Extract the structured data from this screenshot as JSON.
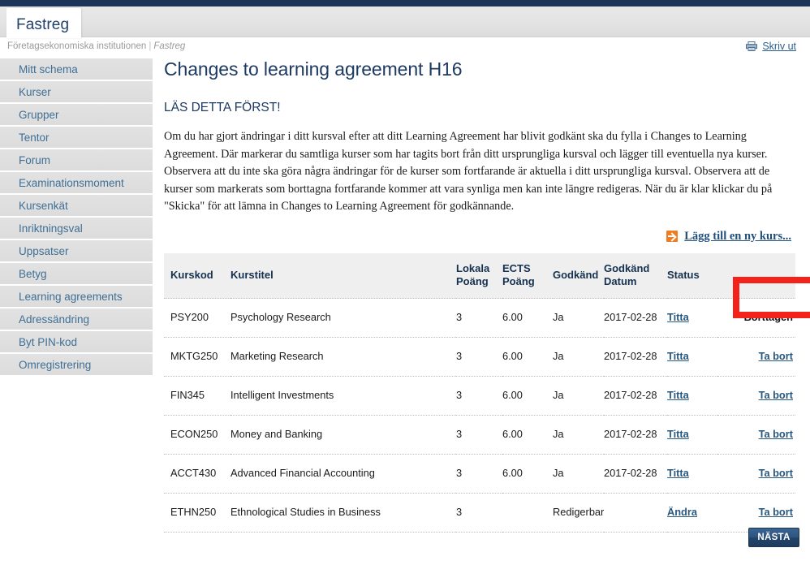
{
  "topbar": {
    "color": "#1d3557"
  },
  "tab": {
    "label": "Fastreg"
  },
  "breadcrumb": {
    "root": "Företagsekonomiska institutionen",
    "separator": "|",
    "current": "Fastreg"
  },
  "print": {
    "label": "Skriv ut",
    "icon": "printer-icon"
  },
  "sidebar": {
    "items": [
      {
        "label": "Mitt schema"
      },
      {
        "label": "Kurser"
      },
      {
        "label": "Grupper"
      },
      {
        "label": "Tentor"
      },
      {
        "label": "Forum"
      },
      {
        "label": "Examinationsmoment"
      },
      {
        "label": "Kursenkät"
      },
      {
        "label": "Inriktningsval"
      },
      {
        "label": "Uppsatser"
      },
      {
        "label": "Betyg"
      },
      {
        "label": "Learning agreements"
      },
      {
        "label": "Adressändring"
      },
      {
        "label": "Byt PIN-kod"
      },
      {
        "label": "Omregistrering"
      }
    ]
  },
  "main": {
    "title": "Changes to learning agreement H16",
    "subhead": "LÄS DETTA FÖRST!",
    "body": "Om du har gjort ändringar i ditt kursval efter att ditt Learning Agreement har blivit godkänt ska du fylla i Changes to Learning Agreement. Där markerar du samtliga kurser som har tagits bort från ditt ursprungliga kursval och lägger till eventuella nya kurser. Observera att du inte ska göra några ändringar för de kurser som fortfarande är aktuella i ditt ursprungliga kursval. Observera att de kurser som markerats som borttagna fortfarande kommer att vara synliga men kan inte längre redigeras. När du är klar klickar du på \"Skicka\" för att lämna in Changes to Learning Agreement för godkännande.",
    "add_course_link": "Lägg till en ny kurs...",
    "next_button": "NÄSTA"
  },
  "table": {
    "headers": {
      "kurskod": "Kurskod",
      "kurstitel": "Kurstitel",
      "lokala_poang": "Lokala Poäng",
      "ects_poang": "ECTS Poäng",
      "godkand": "Godkänd",
      "godkand_datum": "Godkänd Datum",
      "status": "Status",
      "action": ""
    },
    "rows": [
      {
        "kurskod": "PSY200",
        "kurstitel": "Psychology Research",
        "lokala_poang": "3",
        "ects_poang": "6.00",
        "godkand": "Ja",
        "godkand_datum": "2017-02-28",
        "status": "Titta",
        "action": "Borttagen",
        "action_is_link": false,
        "highlighted": true
      },
      {
        "kurskod": "MKTG250",
        "kurstitel": "Marketing Research",
        "lokala_poang": "3",
        "ects_poang": "6.00",
        "godkand": "Ja",
        "godkand_datum": "2017-02-28",
        "status": "Titta",
        "action": "Ta bort",
        "action_is_link": true,
        "highlighted": false
      },
      {
        "kurskod": "FIN345",
        "kurstitel": "Intelligent Investments",
        "lokala_poang": "3",
        "ects_poang": "6.00",
        "godkand": "Ja",
        "godkand_datum": "2017-02-28",
        "status": "Titta",
        "action": "Ta bort",
        "action_is_link": true,
        "highlighted": false
      },
      {
        "kurskod": "ECON250",
        "kurstitel": "Money and Banking",
        "lokala_poang": "3",
        "ects_poang": "6.00",
        "godkand": "Ja",
        "godkand_datum": "2017-02-28",
        "status": "Titta",
        "action": "Ta bort",
        "action_is_link": true,
        "highlighted": false
      },
      {
        "kurskod": "ACCT430",
        "kurstitel": "Advanced Financial Accounting",
        "lokala_poang": "3",
        "ects_poang": "6.00",
        "godkand": "Ja",
        "godkand_datum": "2017-02-28",
        "status": "Titta",
        "action": "Ta bort",
        "action_is_link": true,
        "highlighted": false
      },
      {
        "kurskod": "ETHN250",
        "kurstitel": "Ethnological Studies in Business",
        "lokala_poang": "3",
        "ects_poang": "",
        "godkand": "Redigerbar",
        "godkand_datum": "",
        "status": "Ändra",
        "action": "Ta bort",
        "action_is_link": true,
        "highlighted": false
      }
    ]
  },
  "annotation": {
    "color": "#f3231b",
    "target": "Borttagen"
  }
}
